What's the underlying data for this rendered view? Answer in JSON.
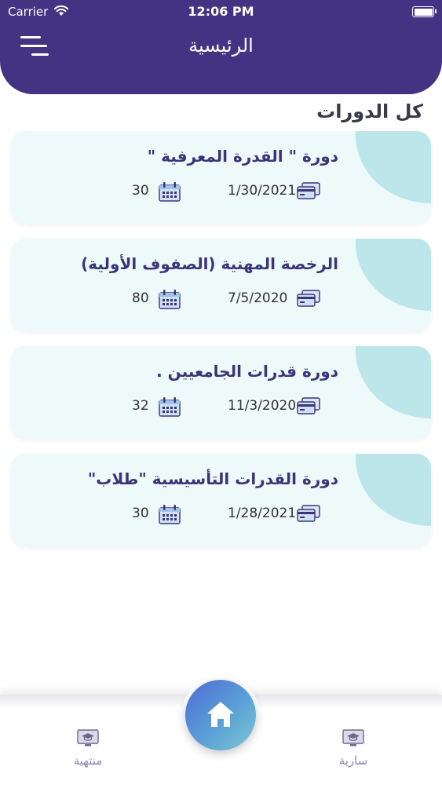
{
  "status_bar": {
    "carrier": "Carrier",
    "time": "12:06 PM",
    "wifi_icon": "wifi-icon",
    "battery_icon": "battery-icon"
  },
  "header": {
    "title": "الرئيسية",
    "menu_icon": "menu-icon",
    "background_color": "#433483"
  },
  "section": {
    "title": "كل الدورات"
  },
  "courses": [
    {
      "title": "دورة \" القدرة المعرفية \"",
      "date": "1/30/2021",
      "count": "30"
    },
    {
      "title": "الرخصة المهنية (الصفوف الأولية)",
      "date": "7/5/2020",
      "count": "80"
    },
    {
      "title": "دورة قدرات الجامعيين .",
      "date": "11/3/2020",
      "count": "32"
    },
    {
      "title": "دورة القدرات التأسيسية \"طلاب\"",
      "date": "1/28/2021",
      "count": "30"
    }
  ],
  "card_icons": {
    "date": "credit-card-icon",
    "count": "calendar-icon"
  },
  "bottom_nav": {
    "ended_label": "منتهية",
    "active_label": "سارية",
    "home_icon": "home-icon",
    "item_icon": "graduation-screen-icon"
  },
  "colors": {
    "primary": "#433483",
    "card_bg": "#eef9fa",
    "card_corner": "#bde6ea",
    "nav_label": "#8f86b6"
  }
}
